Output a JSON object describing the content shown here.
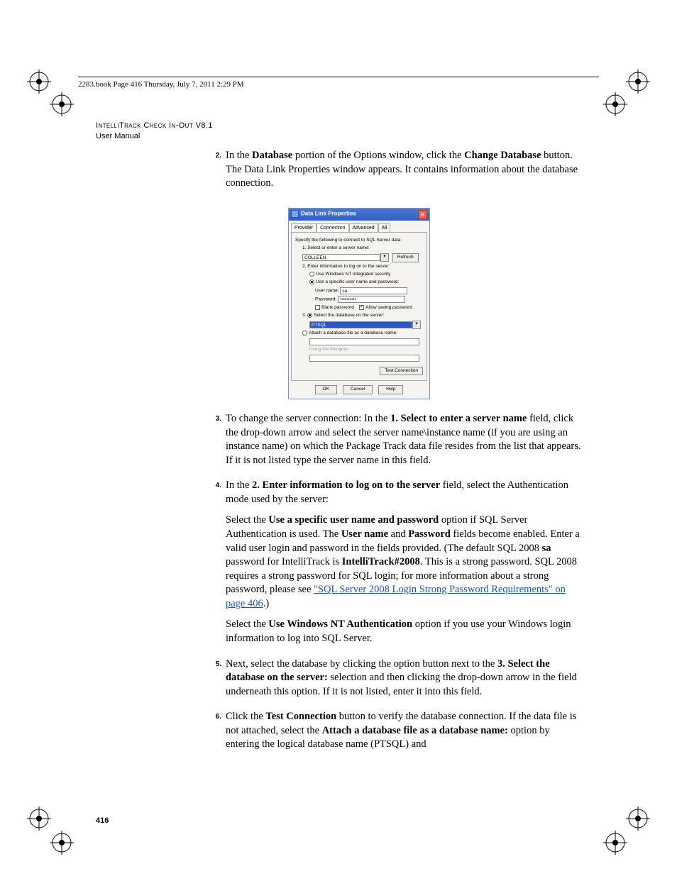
{
  "crop_header": "2283.book  Page 416  Thursday, July 7, 2011  2:29 PM",
  "book": {
    "title_sc": "IntelliTrack Check In-Out V8.1",
    "subtitle": "User Manual"
  },
  "steps": {
    "n2": "2.",
    "t2a": "In the ",
    "t2b": "Database",
    "t2c": " portion of the Options window, click the ",
    "t2d": "Change Database",
    "t2e": " button. The Data Link Properties window appears. It contains information about the database connection.",
    "n3": "3.",
    "t3a": "To change the server connection: In the ",
    "t3b": "1. Select to enter a server name",
    "t3c": " field, click the drop-down arrow and select the server name\\instance name (if you are using an instance name) on which the Package Track data file resides from the list that appears. If it is not listed type the server name in this field.",
    "n4": "4.",
    "t4a": "In the ",
    "t4b": "2. Enter information to log on to the server",
    "t4c": " field, select the Authentication mode used by the server:",
    "t4d": "Select the ",
    "t4e": "Use a specific user name and password",
    "t4f": " option if SQL Server Authentication is used. The ",
    "t4g": "User name",
    "t4h": " and ",
    "t4i": "Password",
    "t4j": " fields become enabled. Enter a valid user login and password in the fields provided. (The default SQL 2008 ",
    "t4k": "sa",
    "t4l": " password for IntelliTrack is ",
    "t4m": "IntelliTrack#2008",
    "t4n": ". This is a strong password. SQL 2008 requires a strong password for SQL login; for more information about a strong password, please see ",
    "t4o": "\"SQL Server 2008 Login Strong Password Requirements\" on page 406",
    "t4p": ".)",
    "t4q": "Select the ",
    "t4r": "Use Windows NT Authentication",
    "t4s": " option if you use your Windows login information to log into SQL Server.",
    "n5": "5.",
    "t5a": "Next, select the database by clicking the option button next to the ",
    "t5b": "3. Select the database on the server:",
    "t5c": " selection and then clicking the drop-down arrow in the field underneath this option. If it is not listed, enter it into this field.",
    "n6": "6.",
    "t6a": "Click the ",
    "t6b": "Test Connection",
    "t6c": " button to verify the database connection. If the data file is not attached, select the ",
    "t6d": "Attach a database file as a database name:",
    "t6e": " option by entering the logical database name (PTSQL) and"
  },
  "dialog": {
    "title": "Data Link Properties",
    "tabs": {
      "t1": "Provider",
      "t2": "Connection",
      "t3": "Advanced",
      "t4": "All"
    },
    "heading": "Specify the following to connect to SQL Server data:",
    "s1": "1. Select or enter a server name:",
    "server": "COLLEEN",
    "refresh": "Refresh",
    "s2": "2. Enter information to log on to the server:",
    "r_nt": "Use Windows NT Integrated security",
    "r_spec": "Use a specific user name and password:",
    "user_lbl": "User name:",
    "user_val": "sa",
    "pass_lbl": "Password:",
    "pass_val": "••••••••••",
    "blank": "Blank password",
    "allow": "Allow saving password",
    "s3": "3.",
    "r_db": "Select the database on the server:",
    "db_val": "PTSQL",
    "r_attach": "Attach a database file as a database name:",
    "using": "Using the filename:",
    "test": "Test Connection",
    "ok": "OK",
    "cancel": "Cancel",
    "help": "Help"
  },
  "page_number": "416"
}
